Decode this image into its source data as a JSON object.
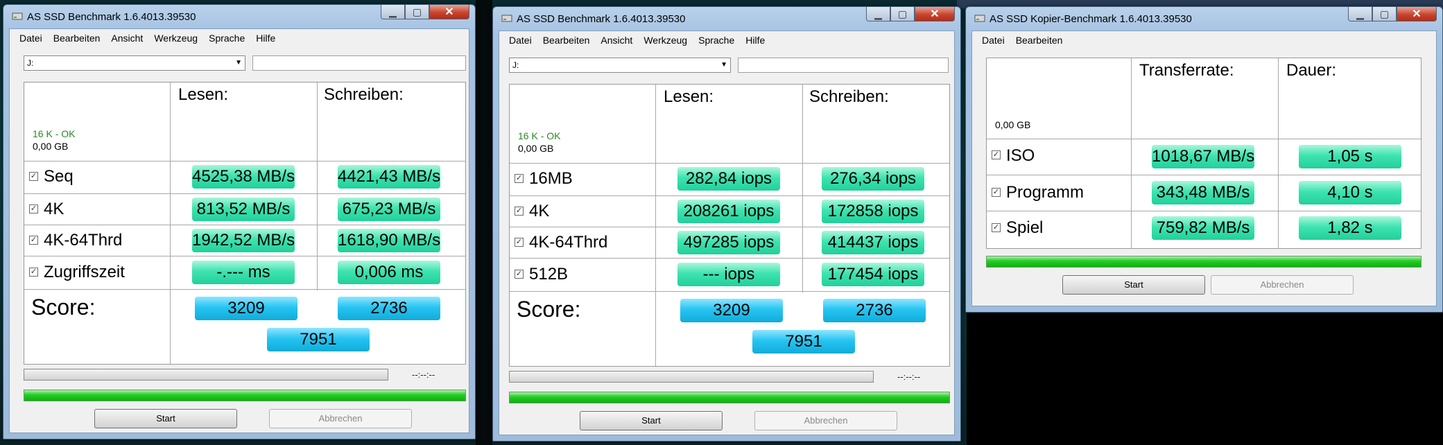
{
  "windows": [
    {
      "title": "AS SSD Benchmark 1.6.4013.39530",
      "menu": [
        "Datei",
        "Bearbeiten",
        "Ansicht",
        "Werkzeug",
        "Sprache",
        "Hilfe"
      ],
      "drive": "J:",
      "status_ok": "16 K - OK",
      "size": "0,00 GB",
      "col_read": "Lesen:",
      "col_write": "Schreiben:",
      "rows": [
        {
          "label": "Seq",
          "read": "4525,38 MB/s",
          "write": "4421,43 MB/s"
        },
        {
          "label": "4K",
          "read": "813,52 MB/s",
          "write": "675,23 MB/s"
        },
        {
          "label": "4K-64Thrd",
          "read": "1942,52 MB/s",
          "write": "1618,90 MB/s"
        },
        {
          "label": "Zugriffszeit",
          "read": "-.--- ms",
          "write": "0,006 ms"
        }
      ],
      "score_label": "Score:",
      "score_read": "3209",
      "score_write": "2736",
      "score_total": "7951",
      "timer": "--:--:--",
      "start": "Start",
      "cancel": "Abbrechen"
    },
    {
      "title": "AS SSD Benchmark 1.6.4013.39530",
      "menu": [
        "Datei",
        "Bearbeiten",
        "Ansicht",
        "Werkzeug",
        "Sprache",
        "Hilfe"
      ],
      "drive": "J:",
      "status_ok": "16 K - OK",
      "size": "0,00 GB",
      "col_read": "Lesen:",
      "col_write": "Schreiben:",
      "rows": [
        {
          "label": "16MB",
          "read": "282,84 iops",
          "write": "276,34 iops"
        },
        {
          "label": "4K",
          "read": "208261 iops",
          "write": "172858 iops"
        },
        {
          "label": "4K-64Thrd",
          "read": "497285 iops",
          "write": "414437 iops"
        },
        {
          "label": "512B",
          "read": "--- iops",
          "write": "177454 iops"
        }
      ],
      "score_label": "Score:",
      "score_read": "3209",
      "score_write": "2736",
      "score_total": "7951",
      "timer": "--:--:--",
      "start": "Start",
      "cancel": "Abbrechen"
    },
    {
      "title": "AS SSD Kopier-Benchmark 1.6.4013.39530",
      "menu": [
        "Datei",
        "Bearbeiten"
      ],
      "size": "0,00 GB",
      "col_rate": "Transferrate:",
      "col_time": "Dauer:",
      "rows": [
        {
          "label": "ISO",
          "rate": "1018,67 MB/s",
          "time": "1,05 s"
        },
        {
          "label": "Programm",
          "rate": "343,48 MB/s",
          "time": "4,10 s"
        },
        {
          "label": "Spiel",
          "rate": "759,82 MB/s",
          "time": "1,82 s"
        }
      ],
      "start": "Start",
      "cancel": "Abbrechen"
    }
  ],
  "icons": {
    "checkbox": "checkmark-icon",
    "minimize": "minimize-icon",
    "maximize": "maximize-icon",
    "close": "close-icon",
    "app": "drive-icon",
    "dropdown": "chevron-down-icon"
  },
  "colors": {
    "value_cell": "#3ee3b0",
    "score_cell": "#27c4f2",
    "progress_fill": "#24cc24"
  }
}
